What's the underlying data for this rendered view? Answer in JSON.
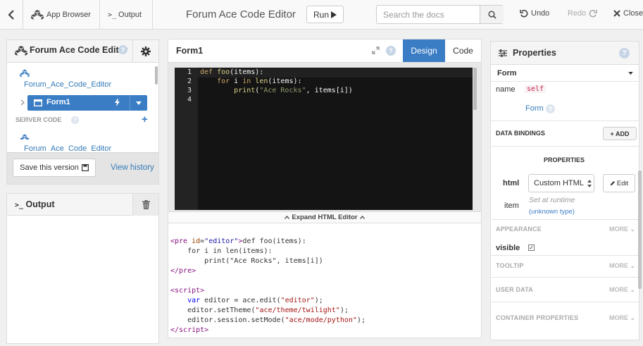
{
  "topbar": {
    "app_browser": "App Browser",
    "output": "Output",
    "title": "Forum Ace Code Editor",
    "run": "Run",
    "search_placeholder": "Search the docs",
    "undo": "Undo",
    "redo": "Redo",
    "close": "Close"
  },
  "left_panel": {
    "app_name": "Forum Ace Code Editor",
    "tree_app": "Forum_Ace_Code_Editor",
    "tree_form": "Form1",
    "server_code": "SERVER CODE",
    "server_item": "Forum_Ace_Code_Editor",
    "save_version": "Save this version",
    "view_history": "View history"
  },
  "output_panel": {
    "title": "Output"
  },
  "center": {
    "form_title": "Form1",
    "tab_design": "Design",
    "tab_code": "Code",
    "line_numbers": [
      "1",
      "2",
      "3",
      "4"
    ],
    "expand_html": "Expand HTML Editor"
  },
  "properties": {
    "title": "Properties",
    "selected": "Form",
    "name_label": "name",
    "name_value": "self",
    "type_link": "Form",
    "data_bindings": "DATA BINDINGS",
    "add": "+ ADD",
    "props_heading": "PROPERTIES",
    "html_label": "html",
    "html_value": "Custom HTML",
    "edit": "Edit",
    "item_label": "item",
    "item_note": "Set at runtime",
    "item_type": "(unknown type)",
    "appearance": "APPEARANCE",
    "more": "MORE",
    "visible_label": "visible",
    "tooltip": "TOOLTIP",
    "user_data": "USER DATA",
    "container_properties": "CONTAINER PROPERTIES"
  },
  "colors": {
    "accent": "#3b7dc4",
    "editor_bg": "#141414",
    "keyword": "#cda869"
  }
}
